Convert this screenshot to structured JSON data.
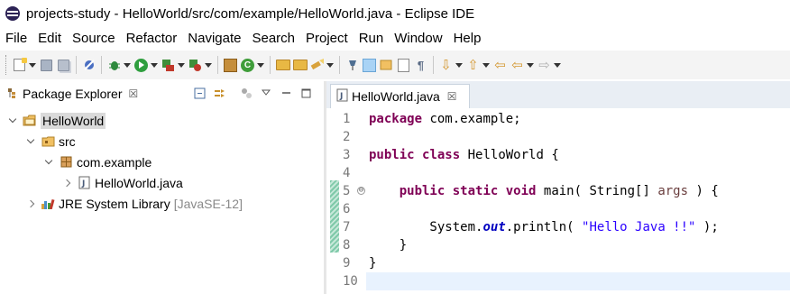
{
  "window": {
    "title": "projects-study - HelloWorld/src/com/example/HelloWorld.java - Eclipse IDE"
  },
  "menu": [
    "File",
    "Edit",
    "Source",
    "Refactor",
    "Navigate",
    "Search",
    "Project",
    "Run",
    "Window",
    "Help"
  ],
  "package_explorer": {
    "title": "Package Explorer",
    "close": "☒",
    "tree": {
      "project": "HelloWorld",
      "src": "src",
      "package": "com.example",
      "file": "HelloWorld.java",
      "library": "JRE System Library",
      "library_version": "[JavaSE-12]"
    }
  },
  "editor": {
    "tab_label": "HelloWorld.java",
    "tab_close": "☒",
    "line_numbers": [
      "1",
      "2",
      "3",
      "4",
      "5",
      "6",
      "7",
      "8",
      "9",
      "10"
    ],
    "fold_marker": "⊖",
    "lines": {
      "l1_kw": "package",
      "l1_rest": " com.example;",
      "l3_kw1": "public",
      "l3_kw2": "class",
      "l3_rest": " HelloWorld {",
      "l5_indent": "    ",
      "l5_kw1": "public",
      "l5_kw2": "static",
      "l5_kw3": "void",
      "l5_rest1": " main( String[] ",
      "l5_param": "args",
      "l5_rest2": " ) {",
      "l7_prefix": "        System.",
      "l7_field": "out",
      "l7_mid": ".println( ",
      "l7_str": "\"Hello Java !!\"",
      "l7_end": " );",
      "l8": "    }",
      "l9": "}"
    }
  },
  "colors": {
    "keyword": "#7f0055",
    "string": "#2a00ff",
    "field": "#0000c0",
    "current_line": "#e8f2fe",
    "toolbar_bg": "#f4f4f4",
    "tabbar_bg": "#e9eef4"
  }
}
